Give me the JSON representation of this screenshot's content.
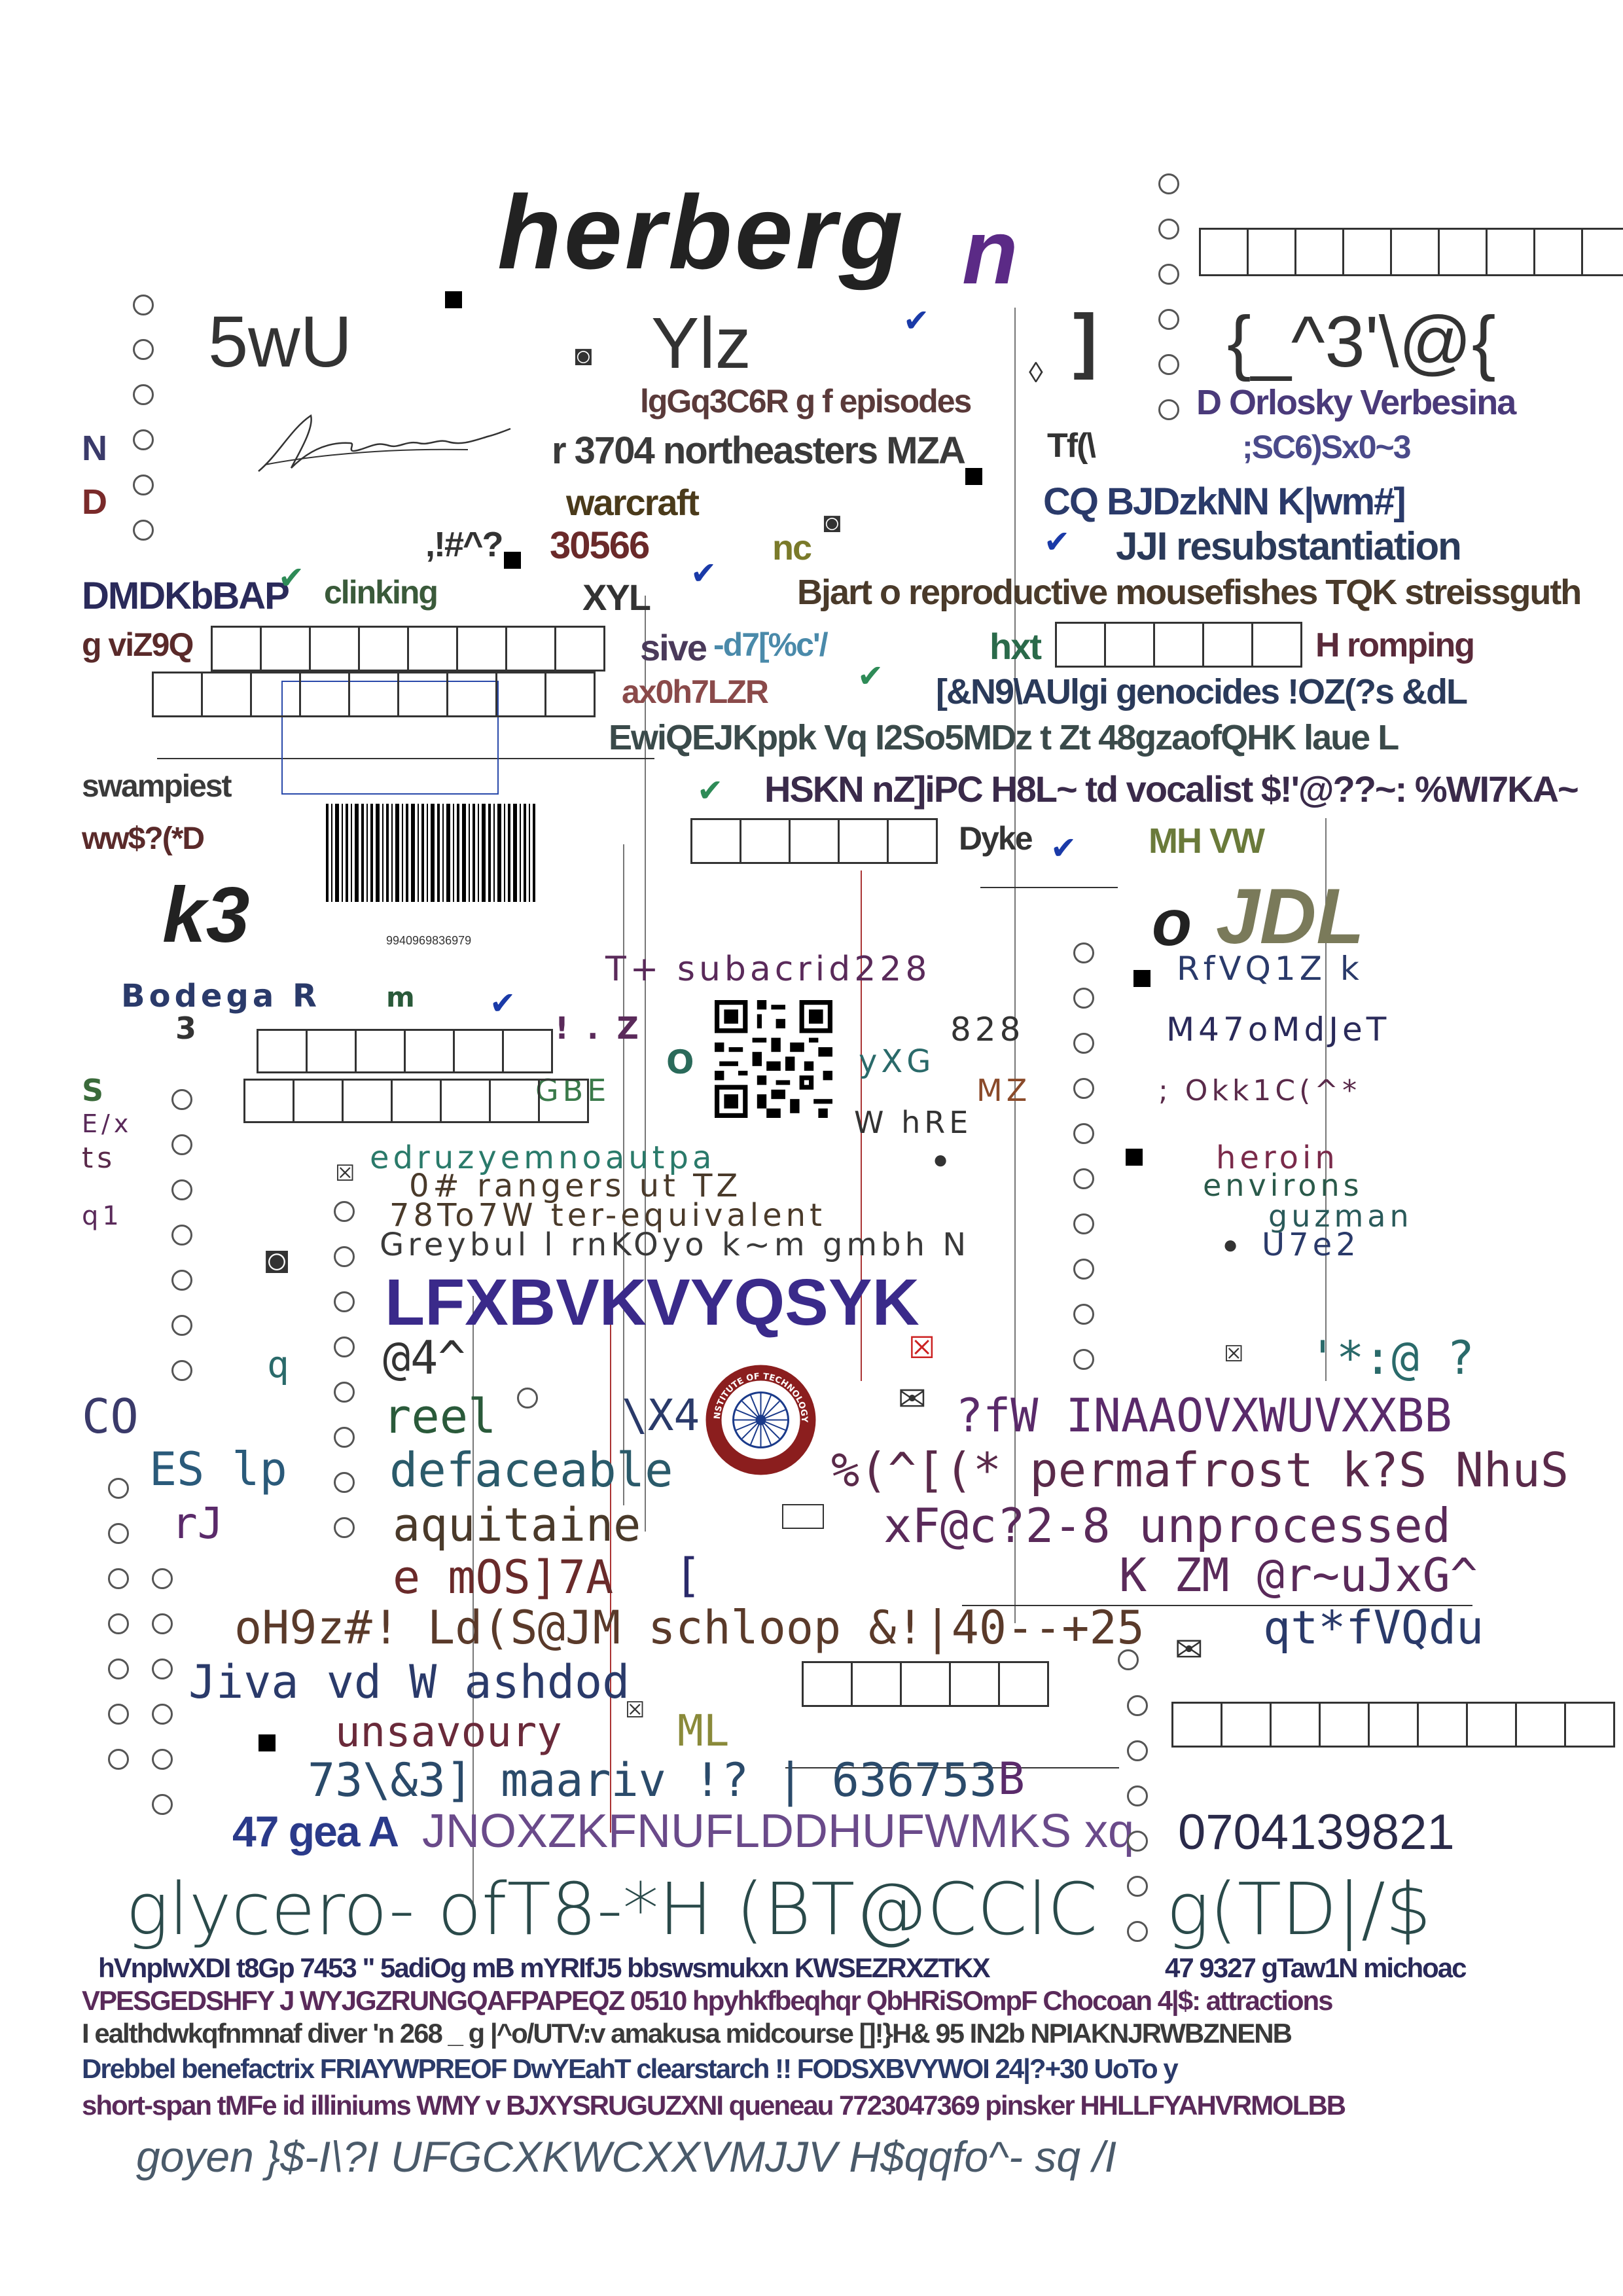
{
  "colors": {
    "ink": "#333333",
    "purple": "#5b2a86",
    "olive": "#7a7a3a",
    "navy": "#2a3a8a",
    "teal": "#2a7a6a",
    "maroon": "#7a2a2a"
  },
  "header": {
    "title": "herberg",
    "title_suffix": "n",
    "left_code": "5wU",
    "center_code": "Ylz",
    "right_code": "{_^3'\\@{",
    "bracket": "]"
  },
  "rows": {
    "r1": [
      "lgGq3C6R g f episodes",
      "D Orlosky Verbesina"
    ],
    "r2": [
      "N",
      "r 3704 northeasters MZA",
      "Tf(\\",
      ";SC6)Sx0~3"
    ],
    "r3": [
      "D",
      "warcraft",
      "CQ BJDzkNN K|wm#]"
    ],
    "r4": [
      ",!#^?",
      "30566",
      "nc",
      "JJI resubstantiation"
    ],
    "r5": [
      "DMDKbBAP",
      "clinking",
      "XYL",
      "Bjart o reproductive mousefishes TQK streissguth"
    ],
    "r6": [
      "g viZ9Q",
      "sive",
      "-d7[%c'/",
      "hxt",
      "H romping"
    ],
    "r7": [
      "ax0h7LZR",
      "[&N9\\AUlgi genocides !OZ(?s &dL"
    ],
    "r8": [
      "EwiQEJKppk Vq I2So5MDz t Zt 48gzaofQHK laue L"
    ],
    "r9": [
      "swampiest",
      "HSKN nZ]iPC H8L~ td vocalist $!'@??~: %WI7KA~"
    ],
    "r10": [
      "ww$?(*D",
      "Dyke",
      "MH VW"
    ]
  },
  "barcode_number": "9940969836979",
  "mid": {
    "k3": "k3",
    "jdl_o": "o",
    "jdl": "JDL",
    "bodega": "Bodega R",
    "m": "m",
    "three": "3",
    "subacrid": "T+ subacrid228",
    "rfvq": "RfVQ1Z k",
    "glyphs1": "! . Z",
    "n828": "828",
    "m470": "M47oMdJeT",
    "o_letter": "O",
    "yxg": "yXG",
    "s": "S",
    "gbe": "GBE",
    "mz": "MZ",
    "okk": "; Okk1C(^*",
    "ez": "E/x",
    "ts": "ts",
    "whre": "W hRE",
    "edruz": "edruzyemnoautpa",
    "heroin": "heroin",
    "rangers": "0# rangers ut TZ",
    "environs": "environs",
    "q1": "q1",
    "equivalent": "78To7W ter-equivalent",
    "guzman": "guzman",
    "greybull": "Greybul l rnKOyo k~m gmbh N",
    "u7e2": "U7e2",
    "lfx": "LFXBVKVYQSYK",
    "at4": "@4^",
    "q": "q",
    "colon": "'*:@ ?",
    "co": "CO",
    "reel": "reel",
    "x4": "\\X4",
    "pfw": "?fW INAAOVXWUVXXBB",
    "es": "ES lp",
    "defaceable": "defaceable",
    "permafrost": "%(^[(* permafrost k?S NhuS",
    "rj": "rJ",
    "aquitaine": "aquitaine",
    "unprocessed": "xF@c?2-8 unprocessed",
    "emos": "e mOS]7A",
    "bracket2": "[",
    "kzm": "K ZM @r~uJxG^",
    "schloop": "oH9z#! Ld(S@JM schloop &!|40--+25",
    "qtf": "qt*fVQdu",
    "jiva": "Jiva vd W ashdod",
    "unsavoury": "unsavoury",
    "ml": "ML",
    "maarv": "73\\&3] maariv !? | 636753",
    "b": "B",
    "gea": "47 gea A",
    "jnox": "JNOXZKFNUFLDDHUFWMKS xq",
    "phone": "0704139821"
  },
  "logo_text": "INSTITUTE OF TECHNOLOGY",
  "bottom": {
    "glycero": "glycero- ofT8-*H (BT@CClC",
    "gtd": "g(TD|/$",
    "l1": "hVnpIwXDI t8Gp 7453 \" 5adiOg mB mYRIfJ5 bbswsmukxn KWSEZRXZTKX",
    "l1b": "47 9327 gTaw1N michoac",
    "l2": "VPESGEDSHFY J WYJGZRUNGQAFPAPEQZ 0510 hpyhkfbeqhqr QbHRiSOmpF Chocoan 4|$: attractions",
    "l3": "I ealthdwkqfnmnaf diver 'n 268 _ g |^o/UTV:v amakusa midcourse []!}H& 95 IN2b NPIAKNJRWBZNENB",
    "l4": "Drebbel benefactrix FRIAYWPREOF DwYEahT clearstarch !! FODSXBVYWOI 24|?+30 UoTo y",
    "l5": "short-span tMFe id illiniums WMY v BJXYSRUGUZXNI queneau 7723047369 pinsker HHLLFYAHVRMOLBB",
    "l6": "goyen }$-I\\?I UFGCXKWCXXVMJJV H$qqfo^- sq /I"
  }
}
